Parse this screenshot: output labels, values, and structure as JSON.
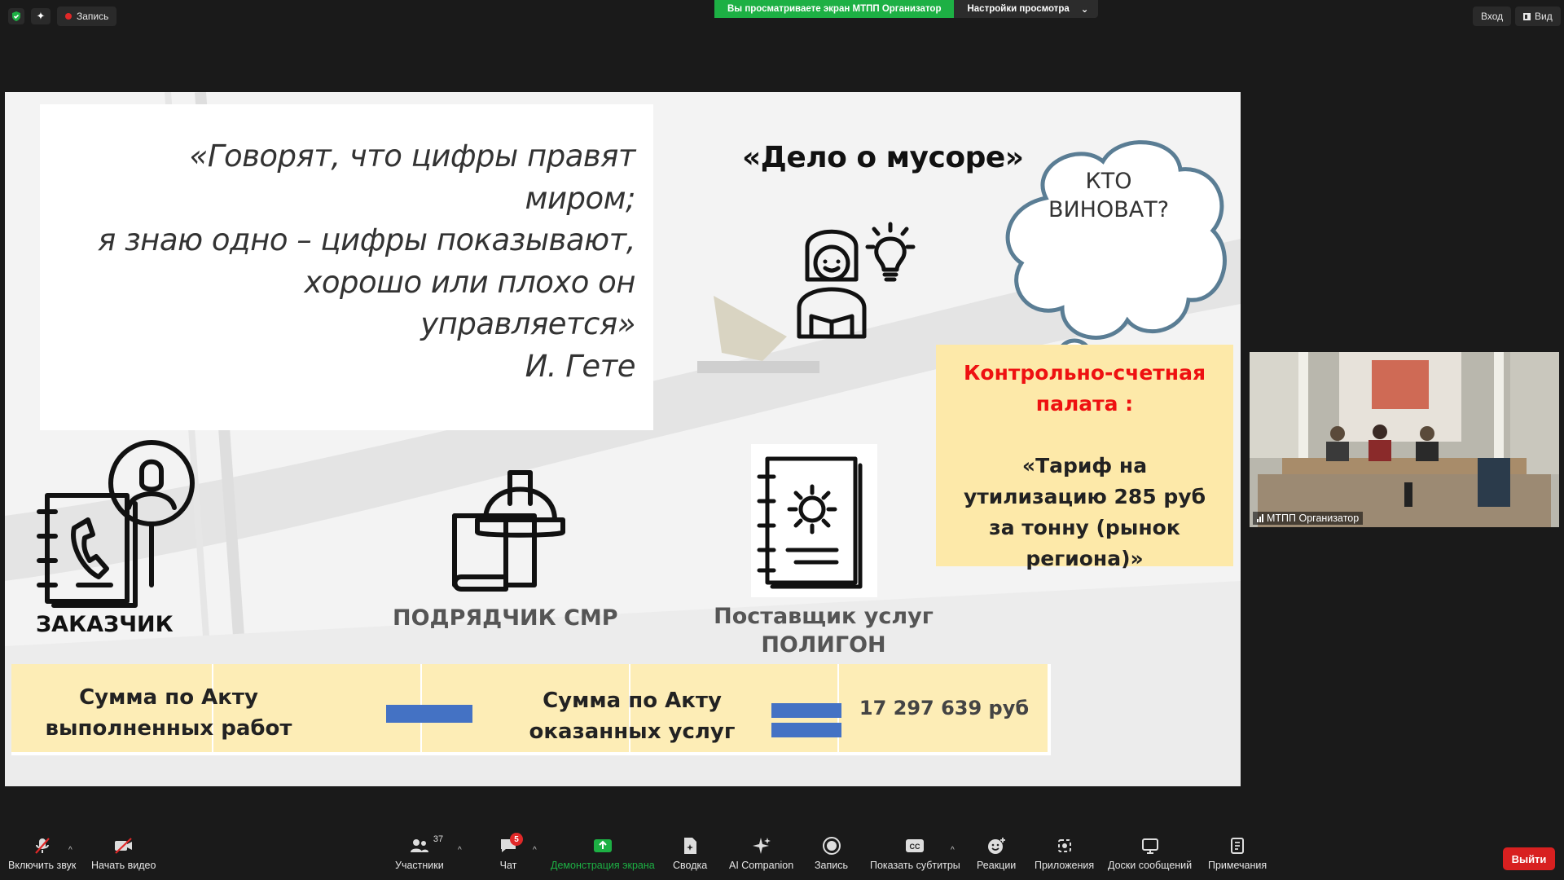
{
  "topbar": {
    "record_label": "Запись",
    "share_banner": "Вы просматриваете экран МТПП Организатор",
    "view_settings": "Настройки просмотра",
    "enter_label": "Вход",
    "view_label": "Вид"
  },
  "slide": {
    "quote_lines": [
      "«Говорят, что цифры правят",
      "миром;",
      "я знаю одно – цифры показывают,",
      "хорошо или плохо он",
      "управляется»",
      "И. Гете"
    ],
    "case_title": "«Дело о мусоре»",
    "cloud_text": "КТО ВИНОВАТ?",
    "ksp_title": "Контрольно-счетная палата :",
    "ksp_body": "«Тариф на утилизацию 285 руб за тонну (рынок региона)»",
    "customer_label": "ЗАКАЗЧИК",
    "contractor_label": "ПОДРЯДЧИК СМР",
    "supplier_label": "Поставщик услуг ПОЛИГОН",
    "sum_works": "Сумма по Акту выполненных работ",
    "sum_services": "Сумма по Акту оказанных услуг",
    "sum_total": "17 297 639 руб",
    "accent_blue": "#4472c4",
    "highlight_yellow": "#fde9a9"
  },
  "video": {
    "participant_name": "МТПП Организатор"
  },
  "toolbar": {
    "mute": "Включить звук",
    "video": "Начать видео",
    "participants": "Участники",
    "participants_count": "37",
    "chat": "Чат",
    "chat_badge": "5",
    "share": "Демонстрация экрана",
    "summary": "Сводка",
    "ai": "AI Companion",
    "record": "Запись",
    "captions": "Показать субтитры",
    "reactions": "Реакции",
    "apps": "Приложения",
    "whiteboards": "Доски сообщений",
    "notes": "Примечания",
    "leave": "Выйти"
  }
}
